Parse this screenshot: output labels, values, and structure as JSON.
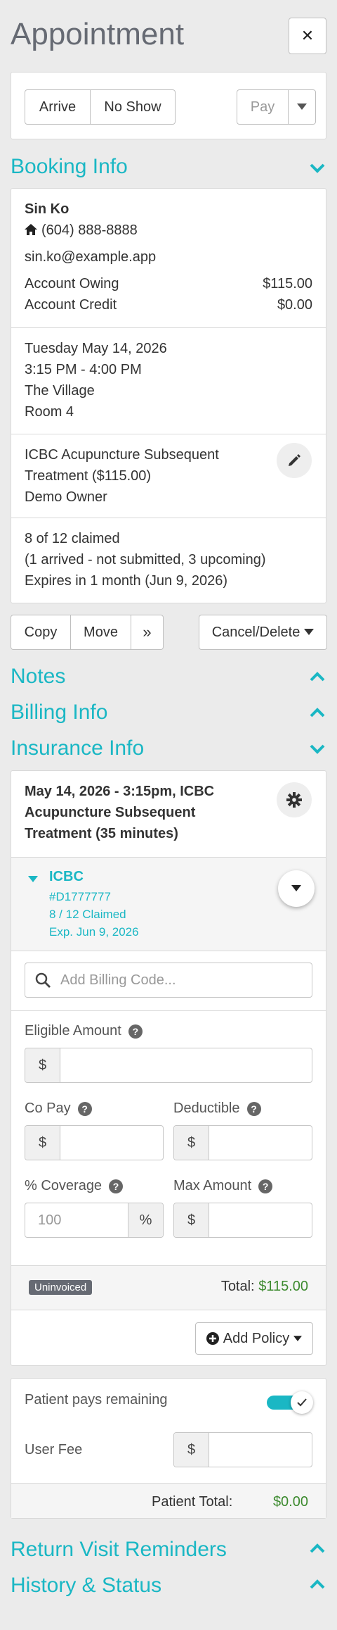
{
  "header": {
    "title": "Appointment",
    "close_label": "✕"
  },
  "actions": {
    "arrive": "Arrive",
    "no_show": "No Show",
    "pay": "Pay"
  },
  "sections": {
    "booking": "Booking Info",
    "notes": "Notes",
    "billing": "Billing Info",
    "insurance": "Insurance Info",
    "reminders": "Return Visit Reminders",
    "history": "History & Status"
  },
  "patient": {
    "name": "Sin Ko",
    "phone": "(604) 888-8888",
    "email": "sin.ko@example.app",
    "owing_label": "Account Owing",
    "owing_value": "$115.00",
    "credit_label": "Account Credit",
    "credit_value": "$0.00"
  },
  "booking": {
    "date": "Tuesday May 14, 2026",
    "time": "3:15 PM - 4:00 PM",
    "location": "The Village",
    "room": "Room 4",
    "service_line1": "ICBC Acupuncture Subsequent",
    "service_line2": "Treatment ($115.00)",
    "owner": "Demo Owner",
    "claimed": "8 of 12 claimed",
    "claim_detail": "(1 arrived - not submitted, 3 upcoming)",
    "expires": "Expires in 1 month (Jun 9, 2026)"
  },
  "appt_actions": {
    "copy": "Copy",
    "move": "Move",
    "more": "»",
    "cancel_delete": "Cancel/Delete"
  },
  "insurance": {
    "title_line1": "May 14, 2026 - 3:15pm, ICBC",
    "title_line2": "Acupuncture Subsequent",
    "title_line3": "Treatment (35 minutes)",
    "policy_name": "ICBC",
    "policy_number": "#D1777777",
    "policy_claimed": "8 / 12 Claimed",
    "policy_expiry": "Exp. Jun 9, 2026",
    "billing_code_placeholder": "Add Billing Code...",
    "eligible_label": "Eligible Amount",
    "copay_label": "Co Pay",
    "deductible_label": "Deductible",
    "coverage_label": "% Coverage",
    "coverage_placeholder": "100",
    "max_label": "Max Amount",
    "currency": "$",
    "percent": "%",
    "status_badge": "Uninvoiced",
    "total_label": "Total:",
    "total_value": "$115.00",
    "add_policy": "Add Policy"
  },
  "patient_pays": {
    "remaining_label": "Patient pays remaining",
    "remaining_on": true,
    "user_fee_label": "User Fee",
    "patient_total_label": "Patient Total:",
    "patient_total_value": "$0.00"
  },
  "colors": {
    "accent": "#1ab7c4",
    "money": "#3c8a2e",
    "badge": "#666a73"
  },
  "icons": {
    "close": "close-icon",
    "caret": "caret-down-icon",
    "home": "home-icon",
    "pencil": "pencil-icon",
    "gear": "gear-icon",
    "search": "search-icon",
    "plus": "plus-circle-icon",
    "check": "check-icon",
    "chevron_up": "chevron-up-icon",
    "chevron_down": "chevron-down-icon"
  }
}
